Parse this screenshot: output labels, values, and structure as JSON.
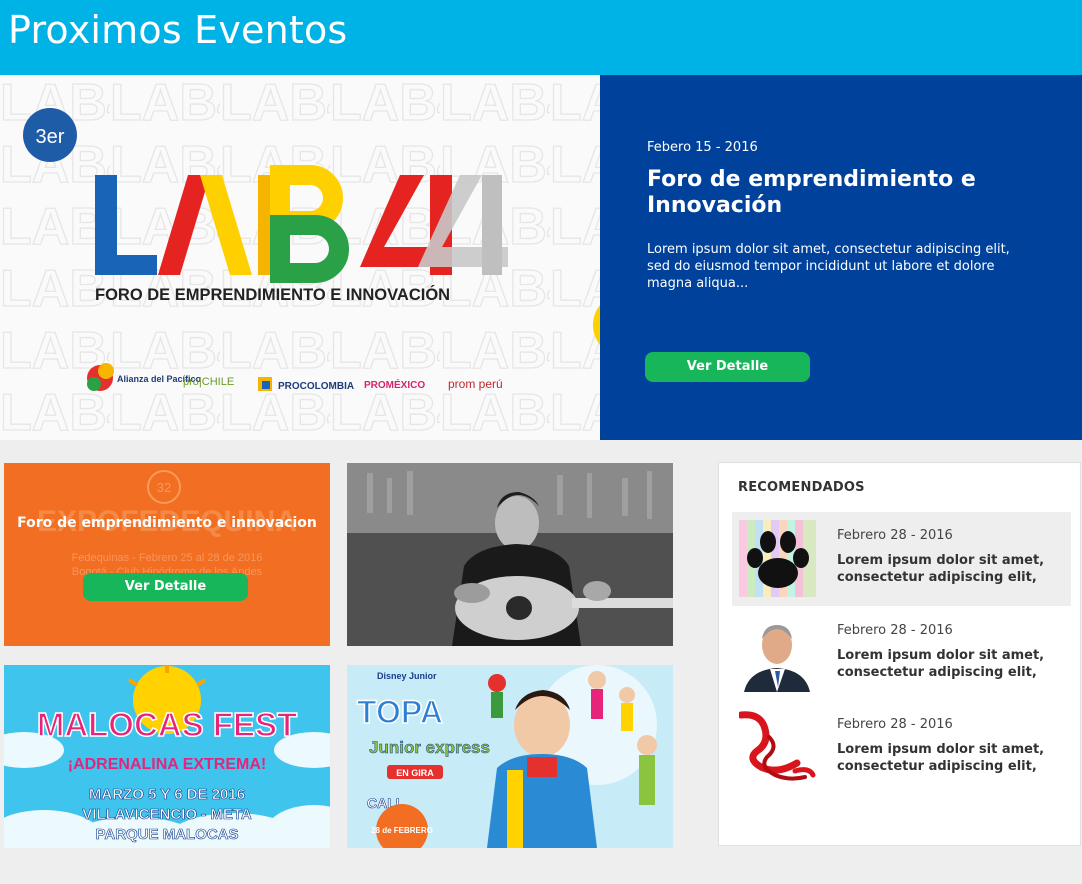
{
  "header": {
    "title": "Proximos Eventos"
  },
  "featured": {
    "badge": "3er",
    "logo_text": "LAB4",
    "logo_subtitle": "FORO DE EMPRENDIMIENTO E INNOVACIÓN",
    "sponsors": [
      "Alianza del Pacífico",
      "pro|CHILE",
      "PROCOLOMBIA",
      "PROMÉXICO",
      "prom perú"
    ],
    "date": "Febero 15 - 2016",
    "title": "Foro de emprendimiento e Innovación",
    "description": "Lorem ipsum dolor sit amet, consectetur adipiscing elit, sed do eiusmod  tempor incididunt ut labore et dolore magna aliqua...",
    "button": "Ver Detalle"
  },
  "tiles": [
    {
      "title": "Foro de emprendimiento e innovacion",
      "bg_text": "EXPOFEDEQUINA",
      "bg_line1": "Fedequinas - Febrero 25 al 28 de 2016",
      "bg_line2": "Bogotá - Club Hipódromo de los Andes",
      "button": "Ver Detalle"
    },
    {
      "image": "guitar-player-photo"
    },
    {
      "line1": "MALOCAS FEST",
      "line2": "¡ADRENALINA EXTREMA!",
      "line3": "MARZO 5 Y 6 DE 2016",
      "line4": "VILLAVICENCIO - META",
      "line5": "PARQUE MALOCAS"
    },
    {
      "brand": "Disney Junior",
      "line1": "TOPA",
      "line2": "Junior express",
      "line3": "EN GIRA",
      "city": "CALI",
      "date": "28 de FEBRERO"
    }
  ],
  "sidebar": {
    "title": "RECOMENDADOS",
    "items": [
      {
        "date": "Febrero 28 - 2016",
        "text": "Lorem ipsum dolor sit amet, consectetur adipiscing elit,",
        "icon": "paw-icon"
      },
      {
        "date": "Febrero 28 - 2016",
        "text": "Lorem ipsum dolor sit amet, consectetur adipiscing elit,",
        "icon": "person-photo"
      },
      {
        "date": "Febrero 28 - 2016",
        "text": "Lorem ipsum dolor sit amet, consectetur adipiscing elit,",
        "icon": "ribbon-icon"
      }
    ]
  },
  "colors": {
    "header": "#00b3e7",
    "featured_panel": "#00429b",
    "button": "#17b65a",
    "orange_tile": "#f26e22"
  }
}
